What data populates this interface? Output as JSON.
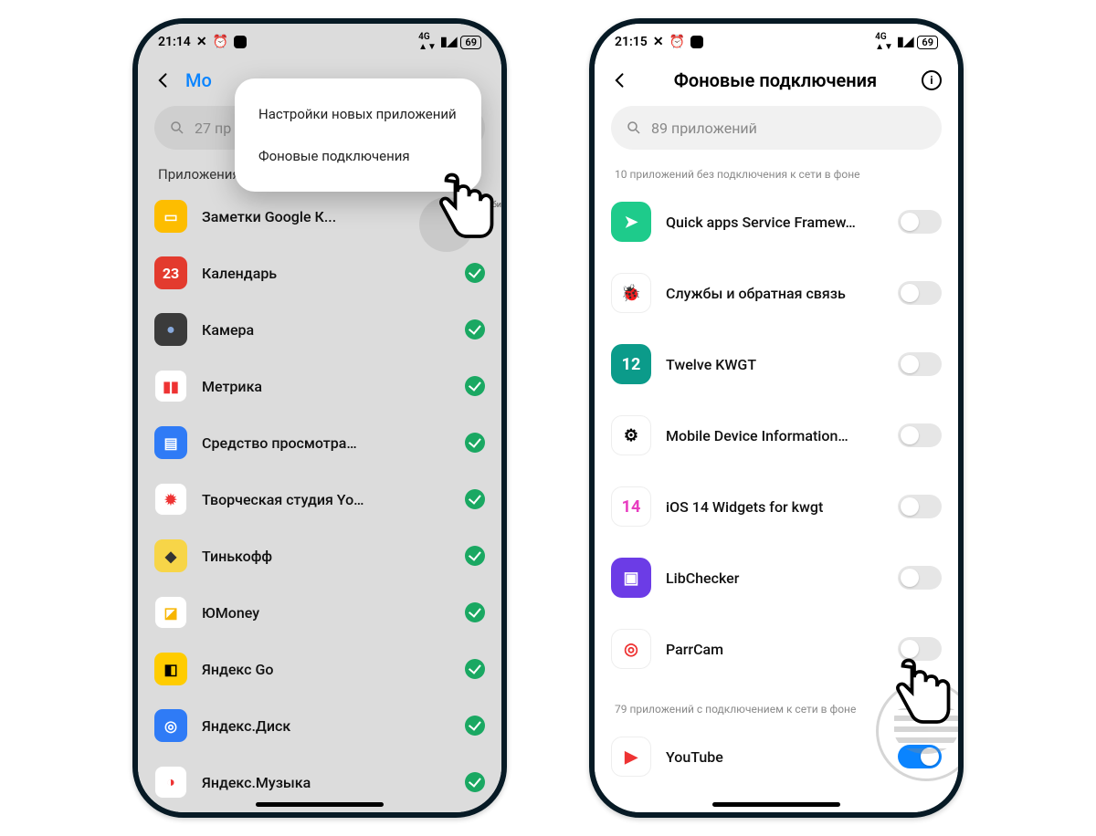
{
  "phone1": {
    "status": {
      "time": "21:14",
      "battery": "69"
    },
    "header": {
      "title_visible": "Мо"
    },
    "search": {
      "text": "27 пр"
    },
    "section_label": "Приложения",
    "bubble": {
      "name": "Моби"
    },
    "menu": {
      "item1": "Настройки новых приложений",
      "item2": "Фоновые подключения"
    },
    "apps": [
      {
        "name": "Заметки Google К...",
        "icon_bg": "#fdbd00",
        "icon_fg": "#fff",
        "glyph": "▭"
      },
      {
        "name": "Календарь",
        "icon_bg": "#e33b2e",
        "icon_fg": "#fff",
        "glyph": "23"
      },
      {
        "name": "Камера",
        "icon_bg": "#3b3b3b",
        "icon_fg": "#8ad",
        "glyph": "●"
      },
      {
        "name": "Метрика",
        "icon_bg": "#ffffff",
        "icon_fg": "#e33",
        "glyph": "▮▮"
      },
      {
        "name": "Средство просмотра…",
        "icon_bg": "#2f7bf6",
        "icon_fg": "#fff",
        "glyph": "▤"
      },
      {
        "name": "Творческая студия Yo…",
        "icon_bg": "#ffffff",
        "icon_fg": "#e33",
        "glyph": "✹"
      },
      {
        "name": "Тинькофф",
        "icon_bg": "#f7d548",
        "icon_fg": "#333",
        "glyph": "◆"
      },
      {
        "name": "ЮMoney",
        "icon_bg": "#ffffff",
        "icon_fg": "#f7b500",
        "glyph": "◪"
      },
      {
        "name": "Яндекс Go",
        "icon_bg": "#ffcc00",
        "icon_fg": "#000",
        "glyph": "◧"
      },
      {
        "name": "Яндекс.Диск",
        "icon_bg": "#2f7bf6",
        "icon_fg": "#fff",
        "glyph": "◎"
      },
      {
        "name": "Яндекс.Музыка",
        "icon_bg": "#ffffff",
        "icon_fg": "#e33",
        "glyph": "◑"
      }
    ]
  },
  "phone2": {
    "status": {
      "time": "21:15",
      "battery": "69"
    },
    "header": {
      "title": "Фоновые подключения"
    },
    "search": {
      "placeholder": "89 приложений"
    },
    "hint_off": "10 приложений без подключения к сети в фоне",
    "hint_on": "79 приложений с подключением к сети в фоне",
    "apps_off": [
      {
        "name": "Quick apps Service Framew…",
        "icon_bg": "#1ecb8b",
        "glyph": "➤"
      },
      {
        "name": "Службы и обратная связь",
        "icon_bg": "#ffffff",
        "glyph": "🐞"
      },
      {
        "name": "Twelve KWGT",
        "icon_bg": "#0b9b8a",
        "glyph": "12"
      },
      {
        "name": "Mobile Device Information…",
        "icon_bg": "#ffffff",
        "glyph": "⚙"
      },
      {
        "name": "iOS 14 Widgets for kwgt",
        "icon_bg": "#ffffff",
        "glyph": "14"
      },
      {
        "name": "LibChecker",
        "icon_bg": "#6c3ce6",
        "glyph": "▣"
      },
      {
        "name": "ParrCam",
        "icon_bg": "#ffffff",
        "glyph": "◎"
      }
    ],
    "apps_on": [
      {
        "name": "YouTube",
        "icon_bg": "#ffffff",
        "glyph": "▶"
      }
    ]
  }
}
